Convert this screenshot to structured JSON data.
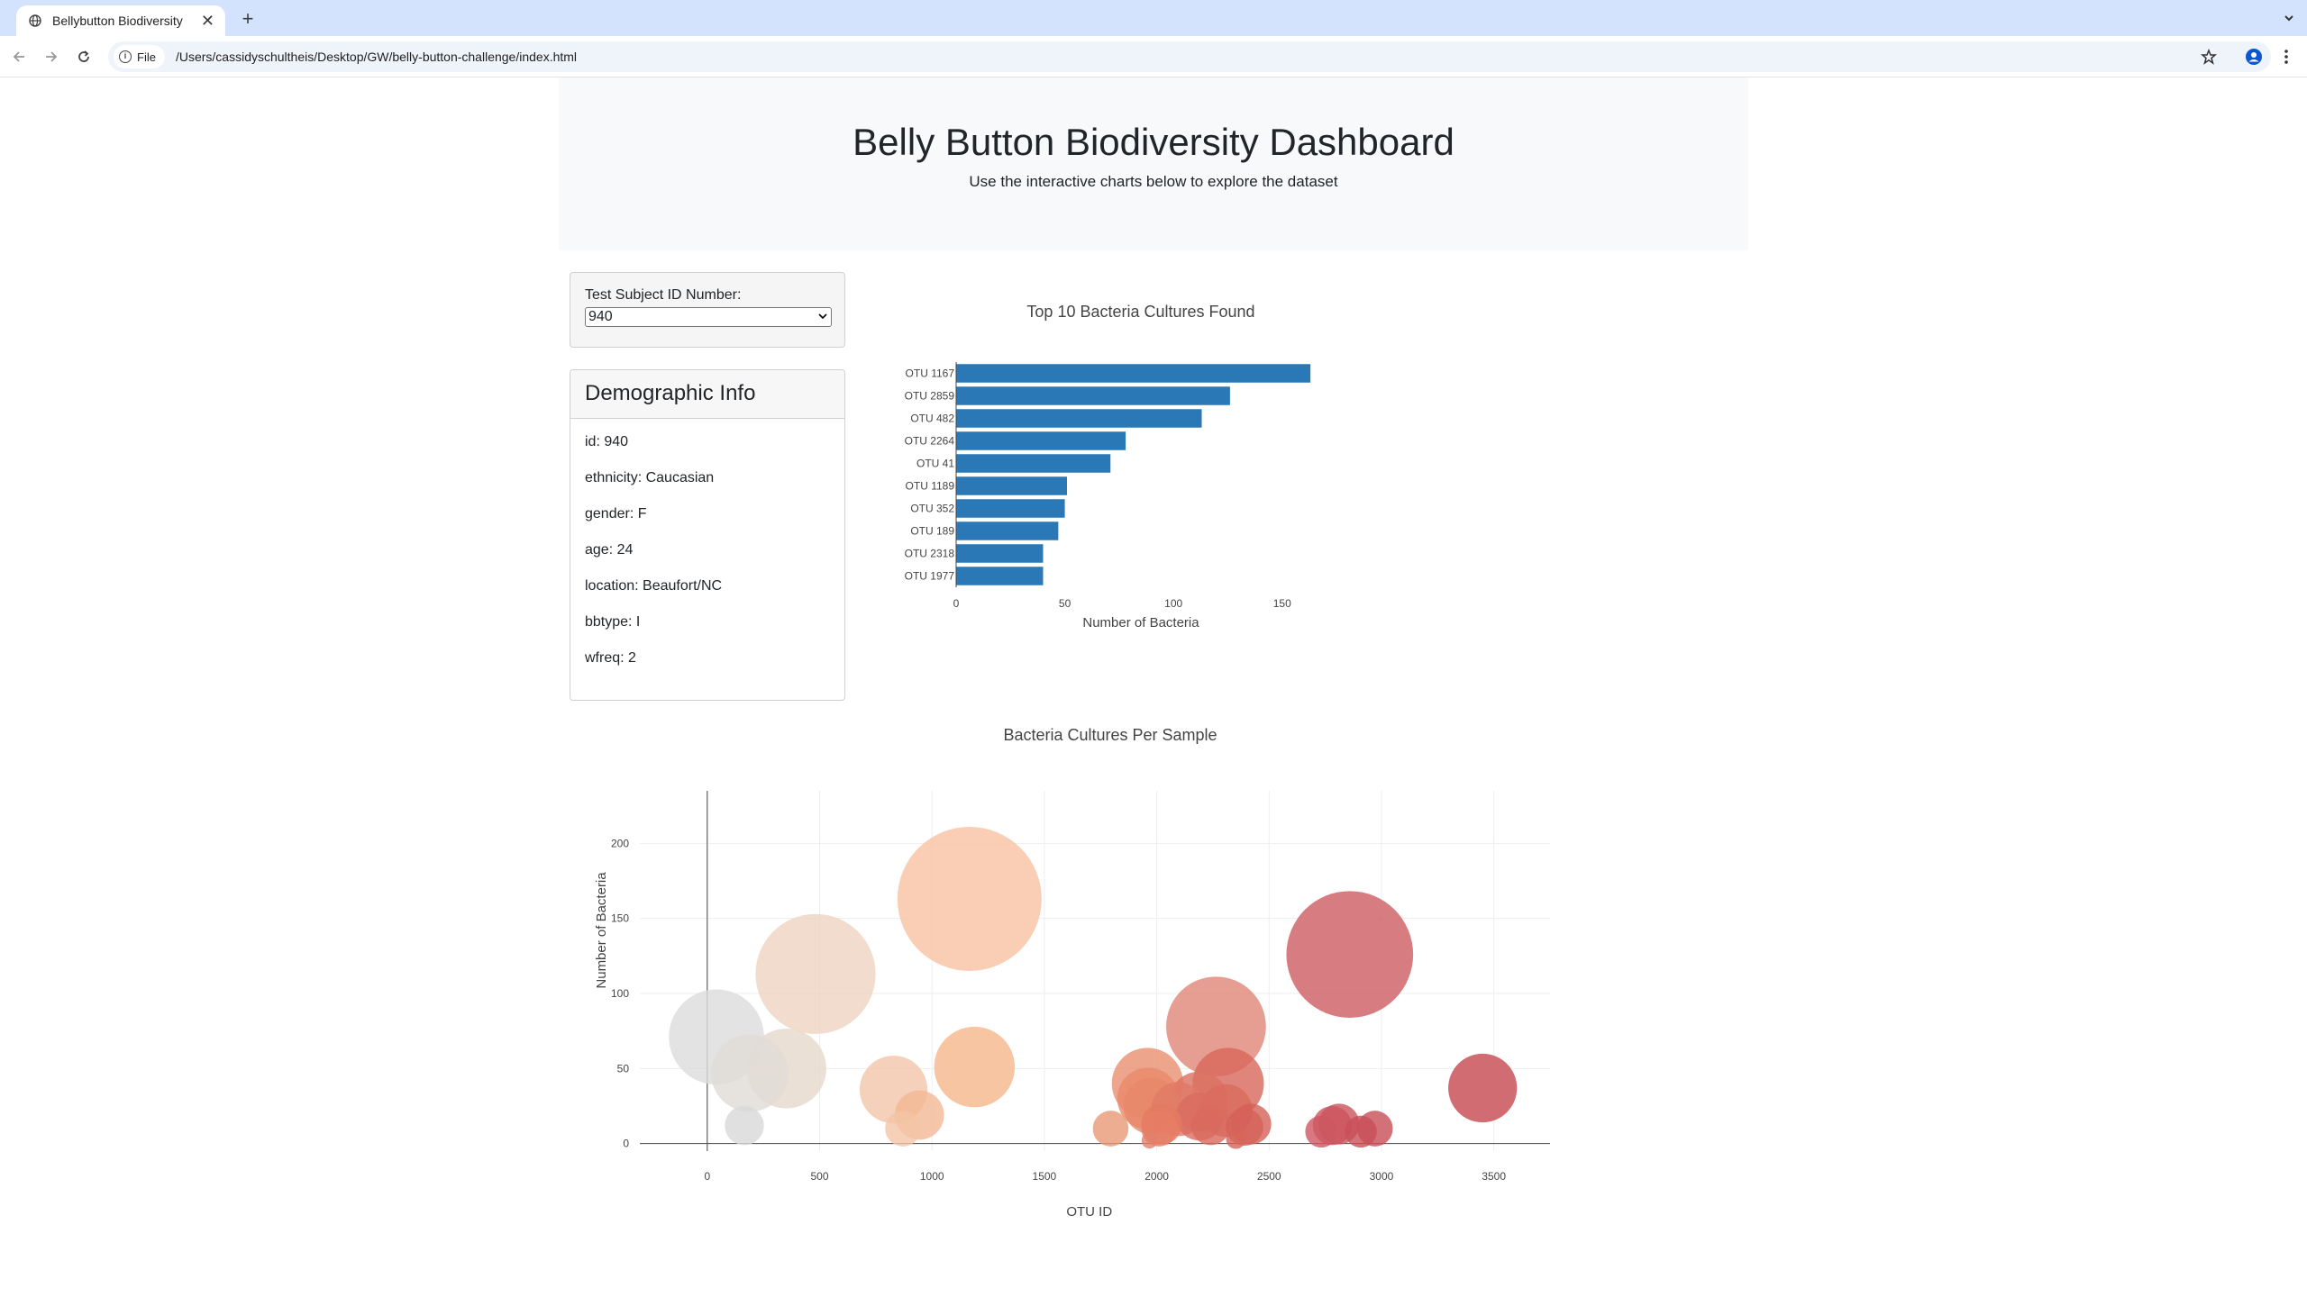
{
  "browser": {
    "tab_title": "Bellybutton Biodiversity",
    "tab_close": "✕",
    "new_tab": "+",
    "file_chip": "File",
    "url": "/Users/cassidyschultheis/Desktop/GW/belly-button-challenge/index.html"
  },
  "header": {
    "title": "Belly Button Biodiversity Dashboard",
    "subtitle": "Use the interactive charts below to explore the dataset"
  },
  "selector": {
    "label": "Test Subject ID Number:",
    "selected": "940"
  },
  "demographics": {
    "heading": "Demographic Info",
    "rows": [
      "id: 940",
      "ethnicity: Caucasian",
      "gender: F",
      "age: 24",
      "location: Beaufort/NC",
      "bbtype: I",
      "wfreq: 2"
    ]
  },
  "chart_data": [
    {
      "type": "bar",
      "orientation": "horizontal",
      "title": "Top 10 Bacteria Cultures Found",
      "xlabel": "Number of Bacteria",
      "ylabel": "",
      "categories": [
        "OTU 1167",
        "OTU 2859",
        "OTU 482",
        "OTU 2264",
        "OTU 41",
        "OTU 1189",
        "OTU 352",
        "OTU 189",
        "OTU 2318",
        "OTU 1977"
      ],
      "values": [
        163,
        126,
        113,
        78,
        71,
        51,
        50,
        47,
        40,
        40
      ],
      "xlim": [
        0,
        170
      ],
      "xticks": [
        0,
        50,
        100,
        150
      ],
      "color": "#2a78b5"
    },
    {
      "type": "scatter",
      "marker": "bubble",
      "title": "Bacteria Cultures Per Sample",
      "xlabel": "OTU ID",
      "ylabel": "Number of Bacteria",
      "xlim": [
        -300,
        3750
      ],
      "ylim": [
        -5,
        235
      ],
      "xticks": [
        0,
        500,
        1000,
        1500,
        2000,
        2500,
        3000,
        3500
      ],
      "yticks": [
        0,
        50,
        100,
        150,
        200
      ],
      "grid": true,
      "colorscale": "Earth-like (grey to tan to red by OTU ID)",
      "x": [
        41,
        165,
        189,
        352,
        482,
        829,
        871,
        944,
        1167,
        1189,
        1795,
        1959,
        1962,
        1977,
        1968,
        2011,
        2022,
        2096,
        2188,
        2191,
        2240,
        2264,
        2308,
        2318,
        2352,
        2391,
        2419,
        2732,
        2781,
        2811,
        2859,
        2908,
        2971,
        3450
      ],
      "y": [
        71,
        12,
        47,
        50,
        113,
        36,
        10,
        19,
        163,
        51,
        10,
        40,
        30,
        25,
        2,
        10,
        13,
        23,
        28,
        18,
        12,
        78,
        22,
        40,
        3,
        11,
        13,
        8,
        12,
        13,
        126,
        8,
        10,
        37
      ],
      "color": [
        "#dcdcdc",
        "#d8d8d8",
        "#e0dcd6",
        "#e6d8ca",
        "#edd3c0",
        "#f3c6ab",
        "#f4c4a6",
        "#f2b893",
        "#f7c2a2",
        "#f6b68b",
        "#e99874",
        "#e98f6f",
        "#e98a6c",
        "#e8876a",
        "#e4806a",
        "#e67d64",
        "#e47a62",
        "#e07a65",
        "#dc7062",
        "#da6d60",
        "#d8695d",
        "#de8676",
        "#d96b5e",
        "#d8675a",
        "#d76459",
        "#d6625a",
        "#d56057",
        "#ce5861",
        "#cc555d",
        "#cb535b",
        "#cd5c63",
        "#c94f59",
        "#c84e58",
        "#c4474f"
      ]
    }
  ]
}
